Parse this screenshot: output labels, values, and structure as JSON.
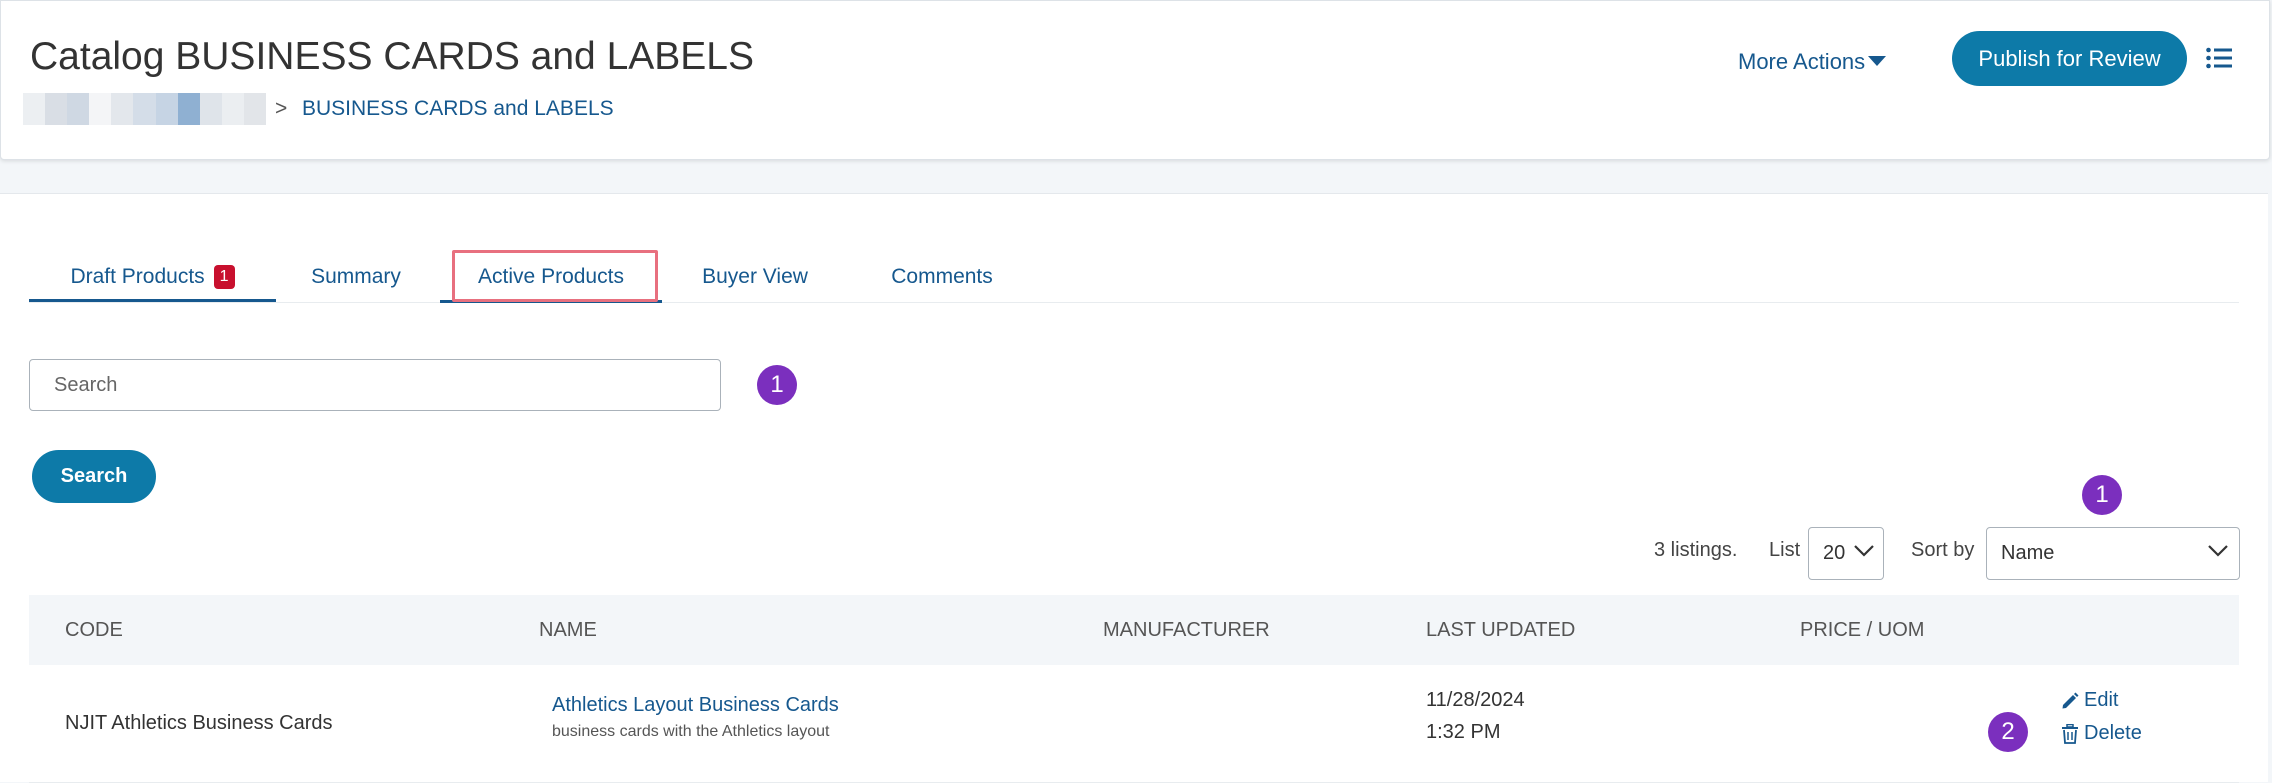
{
  "header": {
    "title": "Catalog BUSINESS CARDS and LABELS",
    "breadcrumb_separator": ">",
    "breadcrumb_current": "BUSINESS CARDS and LABELS",
    "more_actions_label": "More Actions",
    "publish_label": "Publish for Review"
  },
  "tabs": [
    {
      "label": "Draft Products",
      "badge": "1"
    },
    {
      "label": "Summary"
    },
    {
      "label": "Active Products"
    },
    {
      "label": "Buyer View"
    },
    {
      "label": "Comments"
    }
  ],
  "search": {
    "placeholder": "Search",
    "button_label": "Search"
  },
  "markers": [
    "1",
    "1",
    "2"
  ],
  "listing": {
    "count_text": "3 listings.",
    "list_label": "List",
    "list_value": "20",
    "sort_label": "Sort by",
    "sort_value": "Name"
  },
  "table": {
    "columns": [
      "CODE",
      "NAME",
      "MANUFACTURER",
      "LAST UPDATED",
      "PRICE / UOM"
    ],
    "rows": [
      {
        "code": "NJIT Athletics Business Cards",
        "name": "Athletics Layout Business Cards",
        "description": "business cards with the Athletics layout",
        "manufacturer": "",
        "date": "11/28/2024",
        "time": "1:32 PM",
        "price": "",
        "edit_label": "Edit",
        "delete_label": "Delete"
      }
    ]
  },
  "colors": {
    "brand_blue": "#0d7aa8",
    "link_blue": "#16588e",
    "badge_red": "#c8102e",
    "marker_purple": "#7b2fbe",
    "highlight_pink": "#e8707f"
  }
}
